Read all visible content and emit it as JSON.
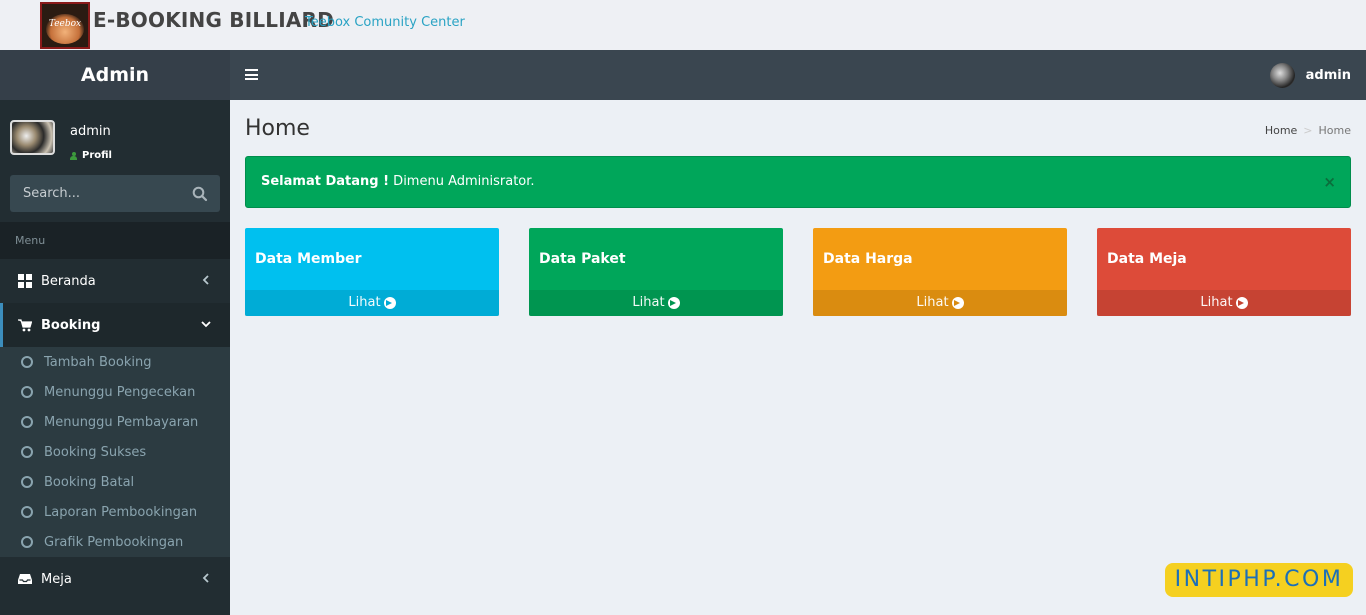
{
  "brand": {
    "logo_text": "Teebox",
    "title": "E-BOOKING BILLIARD",
    "subtitle": "Teebox Comunity Center"
  },
  "header": {
    "sidebar_title": "Admin",
    "username": "admin"
  },
  "sidebar": {
    "user_name": "admin",
    "profile_link": "Profil",
    "search_placeholder": "Search...",
    "menu_header": "Menu",
    "items": [
      {
        "label": "Beranda",
        "icon": "dashboard-icon"
      },
      {
        "label": "Booking",
        "icon": "cart-icon",
        "expanded": true
      },
      {
        "label": "Meja",
        "icon": "inbox-icon"
      }
    ],
    "booking_submenu": [
      "Tambah Booking",
      "Menunggu Pengecekan",
      "Menunggu Pembayaran",
      "Booking Sukses",
      "Booking Batal",
      "Laporan Pembookingan",
      "Grafik Pembookingan"
    ]
  },
  "content": {
    "title": "Home",
    "breadcrumb": {
      "home": "Home",
      "current": "Home"
    },
    "alert": {
      "bold": "Selamat Datang !",
      "text": " Dimenu Adminisrator.",
      "close": "×"
    },
    "boxes": [
      {
        "title": "Data Member",
        "link": "Lihat",
        "color": "#00c0ef"
      },
      {
        "title": "Data Paket",
        "link": "Lihat",
        "color": "#00a65a"
      },
      {
        "title": "Data Harga",
        "link": "Lihat",
        "color": "#f39c12"
      },
      {
        "title": "Data Meja",
        "link": "Lihat",
        "color": "#dd4b39"
      }
    ]
  },
  "watermark": "INTIPHP.COM"
}
